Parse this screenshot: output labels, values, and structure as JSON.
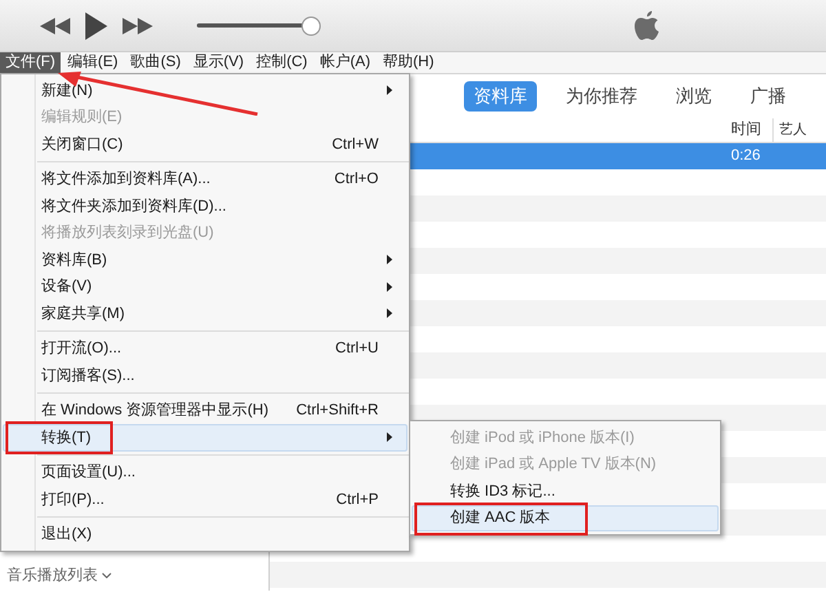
{
  "player": {
    "volume": {
      "level": 1
    }
  },
  "menu_bar": [
    {
      "label": "文件(F)",
      "selected": true
    },
    {
      "label": "编辑(E)",
      "selected": false
    },
    {
      "label": "歌曲(S)",
      "selected": false
    },
    {
      "label": "显示(V)",
      "selected": false
    },
    {
      "label": "控制(C)",
      "selected": false
    },
    {
      "label": "帐户(A)",
      "selected": false
    },
    {
      "label": "帮助(H)",
      "selected": false
    }
  ],
  "tabs": [
    {
      "label": "资料库",
      "selected": true
    },
    {
      "label": "为你推荐",
      "selected": false
    },
    {
      "label": "浏览",
      "selected": false
    },
    {
      "label": "广播",
      "selected": false
    }
  ],
  "table": {
    "columns": [
      "时间",
      "艺人"
    ],
    "rows": [
      {
        "time": "0:26",
        "selected": true
      }
    ]
  },
  "sidebar": {
    "footer": "音乐播放列表"
  },
  "file_menu": [
    {
      "kind": "item",
      "label": "新建(N)",
      "submenu": true,
      "disabled": false,
      "highlighted": false,
      "annotated": false
    },
    {
      "kind": "item",
      "label": "编辑规则(E)",
      "submenu": false,
      "disabled": true,
      "highlighted": false,
      "annotated": false
    },
    {
      "kind": "item",
      "label": "关闭窗口(C)",
      "shortcut": "Ctrl+W",
      "submenu": false,
      "disabled": false,
      "highlighted": false,
      "annotated": false
    },
    {
      "kind": "separator"
    },
    {
      "kind": "item",
      "label": "将文件添加到资料库(A)...",
      "shortcut": "Ctrl+O",
      "submenu": false,
      "disabled": false,
      "highlighted": false,
      "annotated": false
    },
    {
      "kind": "item",
      "label": "将文件夹添加到资料库(D)...",
      "submenu": false,
      "disabled": false,
      "highlighted": false,
      "annotated": false
    },
    {
      "kind": "item",
      "label": "将播放列表刻录到光盘(U)",
      "submenu": false,
      "disabled": true,
      "highlighted": false,
      "annotated": false
    },
    {
      "kind": "item",
      "label": "资料库(B)",
      "submenu": true,
      "disabled": false,
      "highlighted": false,
      "annotated": false
    },
    {
      "kind": "item",
      "label": "设备(V)",
      "submenu": true,
      "disabled": false,
      "highlighted": false,
      "annotated": false
    },
    {
      "kind": "item",
      "label": "家庭共享(M)",
      "submenu": true,
      "disabled": false,
      "highlighted": false,
      "annotated": false
    },
    {
      "kind": "separator"
    },
    {
      "kind": "item",
      "label": "打开流(O)...",
      "shortcut": "Ctrl+U",
      "submenu": false,
      "disabled": false,
      "highlighted": false,
      "annotated": false
    },
    {
      "kind": "item",
      "label": "订阅播客(S)...",
      "submenu": false,
      "disabled": false,
      "highlighted": false,
      "annotated": false
    },
    {
      "kind": "separator"
    },
    {
      "kind": "item",
      "label": "在 Windows 资源管理器中显示(H)",
      "shortcut": "Ctrl+Shift+R",
      "submenu": false,
      "disabled": false,
      "highlighted": false,
      "annotated": false
    },
    {
      "kind": "item",
      "label": "转换(T)",
      "submenu": true,
      "disabled": false,
      "highlighted": true,
      "annotated": true
    },
    {
      "kind": "separator"
    },
    {
      "kind": "item",
      "label": "页面设置(U)...",
      "submenu": false,
      "disabled": false,
      "highlighted": false,
      "annotated": false
    },
    {
      "kind": "item",
      "label": "打印(P)...",
      "shortcut": "Ctrl+P",
      "submenu": false,
      "disabled": false,
      "highlighted": false,
      "annotated": false
    },
    {
      "kind": "separator"
    },
    {
      "kind": "item",
      "label": "退出(X)",
      "submenu": false,
      "disabled": false,
      "highlighted": false,
      "annotated": false
    }
  ],
  "convert_submenu": [
    {
      "label": "创建 iPod 或 iPhone 版本(I)",
      "disabled": true,
      "highlighted": false,
      "annotated": false
    },
    {
      "label": "创建 iPad 或 Apple TV 版本(N)",
      "disabled": true,
      "highlighted": false,
      "annotated": false
    },
    {
      "label": "转换 ID3 标记...",
      "disabled": false,
      "highlighted": false,
      "annotated": false
    },
    {
      "label": "创建 AAC 版本",
      "disabled": false,
      "highlighted": true,
      "annotated": true
    }
  ]
}
